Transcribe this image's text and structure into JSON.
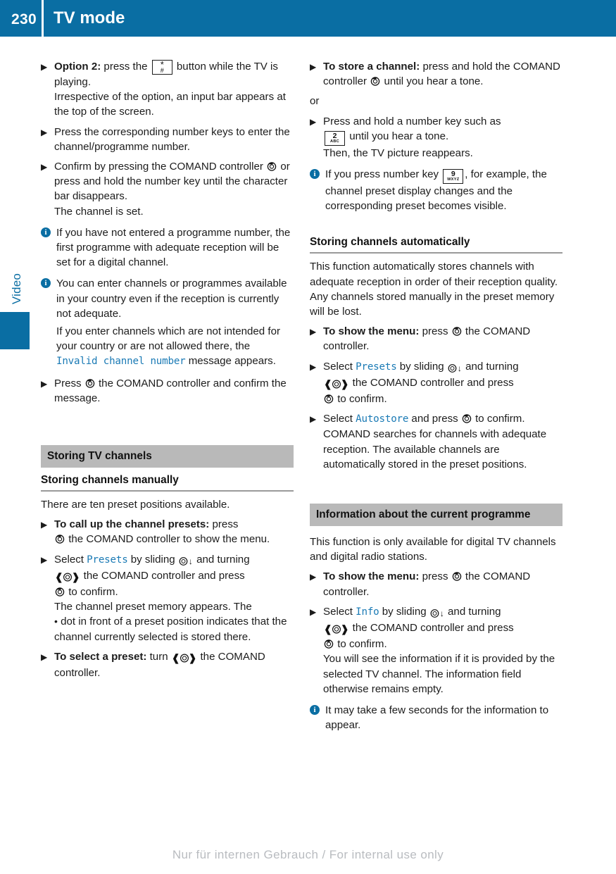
{
  "header": {
    "page_number": "230",
    "title": "TV mode"
  },
  "side_tab": {
    "label": "Video"
  },
  "left_column": {
    "step_option2": {
      "lead": "Option 2:",
      "text_before_key": " press the ",
      "key": {
        "digit": "*",
        "sub": "#"
      },
      "text_after_key": " button while the TV is playing.",
      "continuation": "Irrespective of the option, an input bar appears at the top of the screen."
    },
    "step_numberkeys": "Press the corresponding number keys to enter the channel/programme number.",
    "step_confirm": {
      "before_icon": "Confirm by pressing the COMAND controller ",
      "after_icon": " or press and hold the number key until the character bar disappears.",
      "continuation": "The channel is set."
    },
    "note_programme": "If you have not entered a programme number, the first programme with adequate reception will be set for a digital channel.",
    "note_country": "You can enter channels or programmes available in your country even if the reception is currently not adequate.",
    "note_country_p2_before": "If you enter channels which are not intended for your country or are not allowed there, the ",
    "note_country_code": "Invalid channel number",
    "note_country_p2_after": " message appears.",
    "step_press_confirm": {
      "before_icon": "Press ",
      "after_icon": " the COMAND controller and confirm the message."
    },
    "banner": "Storing TV channels",
    "subhead": "Storing channels manually",
    "intro": "There are ten preset positions available.",
    "step_callup": {
      "lead": "To call up the channel presets:",
      "before_icon": " press ",
      "after_icon": " the COMAND controller to show the menu."
    },
    "step_select_presets": {
      "before_code": "Select ",
      "code": "Presets",
      "mid1": " by sliding ",
      "mid2": " and turning ",
      "mid3": " the COMAND controller and press ",
      "tail": " to confirm.",
      "continuation_a": "The channel preset memory appears. The",
      "continuation_b": " dot in front of a preset position indicates that the channel currently selected is stored there."
    },
    "step_select_preset": {
      "lead": "To select a preset:",
      "before_icon": " turn ",
      "after_icon": " the COMAND controller."
    }
  },
  "right_column": {
    "step_store": {
      "lead": "To store a channel:",
      "before_icon": " press and hold the COMAND controller ",
      "after_icon": " until you hear a tone."
    },
    "or_label": "or",
    "step_hold_key": {
      "before_key": "Press and hold a number key such as ",
      "key": {
        "digit": "2",
        "sub": "ABC"
      },
      "after_key": " until you hear a tone.",
      "continuation": "Then, the TV picture reappears."
    },
    "note_numberkey": {
      "before_key": "If you press number key ",
      "key": {
        "digit": "9",
        "sub": "WXYZ"
      },
      "after_key": ", for example, the channel preset display changes and the corresponding preset becomes visible."
    },
    "subhead_auto": "Storing channels automatically",
    "auto_intro": "This function automatically stores channels with adequate reception in order of their reception quality. Any channels stored manually in the preset memory will be lost.",
    "step_show_menu": {
      "lead": "To show the menu:",
      "before_icon": " press ",
      "after_icon": " the COMAND controller."
    },
    "step_select_presets": {
      "before_code": "Select ",
      "code": "Presets",
      "mid1": " by sliding ",
      "mid2": " and turning ",
      "mid3": " the COMAND controller and press ",
      "tail": " to confirm."
    },
    "step_autostore": {
      "before_code": "Select ",
      "code": "Autostore",
      "mid": " and press ",
      "tail": " to confirm.",
      "continuation": "COMAND searches for channels with adequate reception. The available channels are automatically stored in the preset positions."
    },
    "banner_info": "Information about the current programme",
    "info_intro": "This function is only available for digital TV channels and digital radio stations.",
    "step_show_menu2": {
      "lead": "To show the menu:",
      "before_icon": " press ",
      "after_icon": " the COMAND controller."
    },
    "step_select_info": {
      "before_code": "Select ",
      "code": "Info",
      "mid1": " by sliding ",
      "mid2": " and turning ",
      "mid3": " the COMAND controller and press ",
      "tail": " to confirm.",
      "continuation": "You will see the information if it is provided by the selected TV channel. The information field otherwise remains empty."
    },
    "note_seconds": "It may take a few seconds for the information to appear."
  },
  "footer": {
    "watermark": "Nur für internen Gebrauch / For internal use only"
  },
  "icons": {
    "bullet_arrow": "▶",
    "info_glyph": "i",
    "slide_arrow": "↓",
    "turn_left": "❰",
    "turn_right": "❱",
    "preset_dot": "•"
  },
  "colors": {
    "brand_blue": "#0a6ea3",
    "code_blue": "#1a7ab5",
    "banner_grey": "#b9b9b9"
  }
}
